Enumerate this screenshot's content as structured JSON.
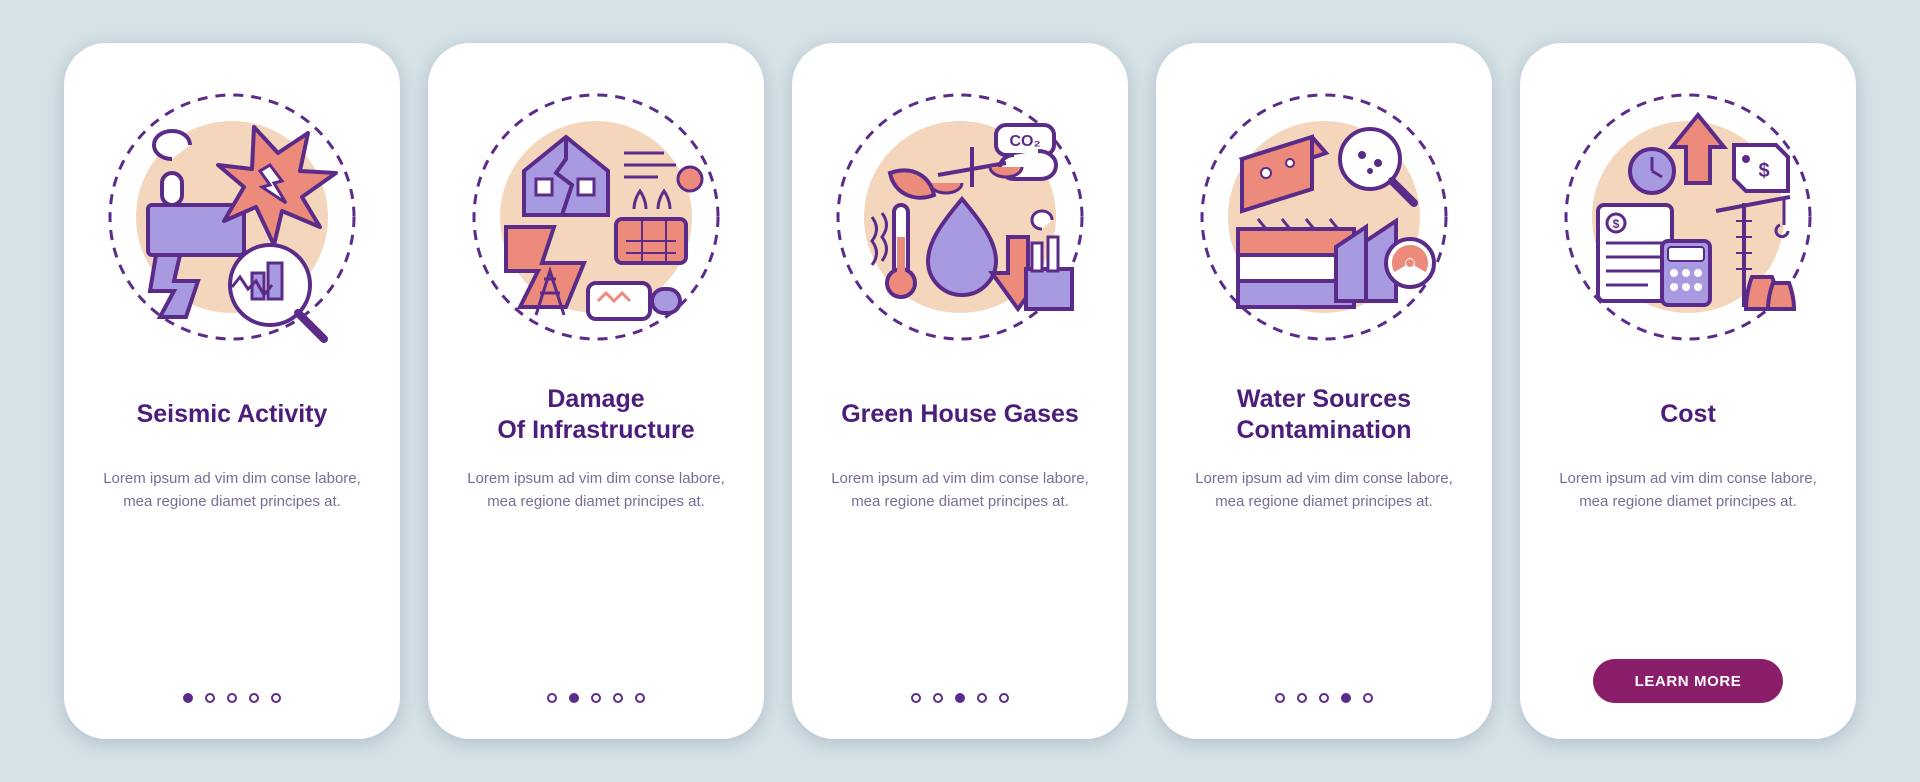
{
  "common_body": "Lorem ipsum ad vim dim conse labore, mea regione diamet principes at.",
  "cta_label": "LEARN MORE",
  "screens": [
    {
      "title": "Seismic Activity"
    },
    {
      "title": "Damage\nOf Infrastructure"
    },
    {
      "title": "Green House Gases"
    },
    {
      "title": "Water Sources\nContamination"
    },
    {
      "title": "Cost"
    }
  ],
  "total_dots": 5
}
